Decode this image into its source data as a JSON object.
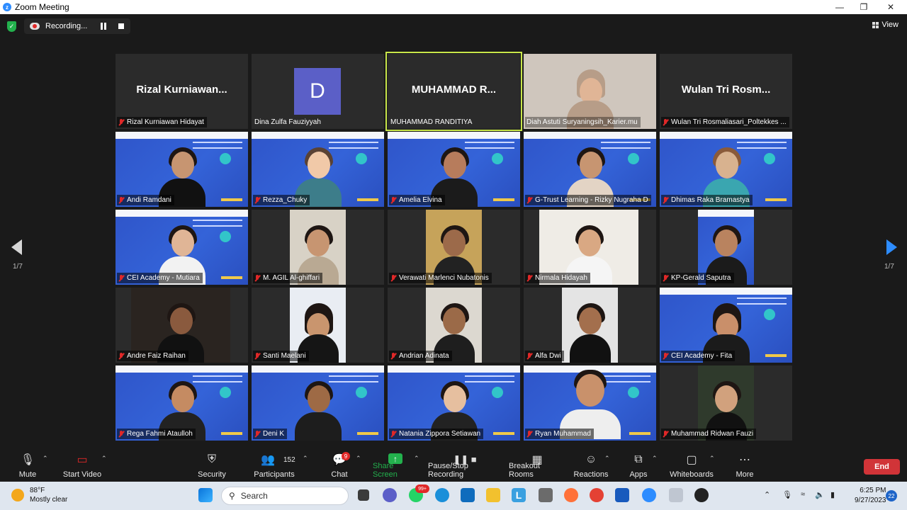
{
  "window": {
    "title": "Zoom Meeting"
  },
  "topbar": {
    "recording_label": "Recording...",
    "view_label": "View"
  },
  "tiles": [
    {
      "name": "Rizal Kurniawan Hidayat",
      "big": "Rizal  Kurniawan..."
    },
    {
      "name": "Dina Zulfa Fauziyyah",
      "avatar": "D"
    },
    {
      "name": "MUHAMMAD RANDITIYA",
      "big": "MUHAMMAD  R..."
    },
    {
      "name": "Diah Astuti Suryaningsih_Karier.mu"
    },
    {
      "name": "Wulan Tri Rosmaliasari_Poltekkes ...",
      "big": "Wulan Tri Rosm..."
    },
    {
      "name": "Andi Ramdani"
    },
    {
      "name": "Rezza_Chuky"
    },
    {
      "name": "Amelia Elvina"
    },
    {
      "name": "G-Trust Learning - Rizky Nugraha D"
    },
    {
      "name": "Dhimas Raka Bramastya"
    },
    {
      "name": "CEI Academy - Mutiara"
    },
    {
      "name": "M. AGIL Al-ghiffari"
    },
    {
      "name": "Verawati Marlenci Nubatonis"
    },
    {
      "name": "Nirmala Hidayah"
    },
    {
      "name": "KP-Gerald Saputra"
    },
    {
      "name": "Andre Faiz Raihan"
    },
    {
      "name": "Santi Maelani"
    },
    {
      "name": "Andrian Adinata"
    },
    {
      "name": "Alfa Dwi"
    },
    {
      "name": "CEI Academy - Fita"
    },
    {
      "name": "Rega Fahmi Ataulloh"
    },
    {
      "name": "Deni K"
    },
    {
      "name": "Natania Zippora Setiawan"
    },
    {
      "name": "Ryan Muhammad"
    },
    {
      "name": "Muhammad Ridwan Fauzi"
    }
  ],
  "pagination": {
    "left": "1/7",
    "right": "1/7"
  },
  "toolbar": {
    "mute": "Mute",
    "start_video": "Start Video",
    "security": "Security",
    "participants": "Participants",
    "participants_count": "152",
    "chat": "Chat",
    "chat_badge": "9",
    "share_screen": "Share Screen",
    "pause_stop_recording": "Pause/Stop Recording",
    "breakout_rooms": "Breakout Rooms",
    "reactions": "Reactions",
    "apps": "Apps",
    "whiteboards": "Whiteboards",
    "more": "More",
    "end": "End"
  },
  "taskbar": {
    "temperature": "88°F",
    "weather": "Mostly clear",
    "search_placeholder": "Search",
    "badge_99": "99+",
    "time": "6:25 PM",
    "date": "9/27/2023",
    "notifications": "22"
  }
}
